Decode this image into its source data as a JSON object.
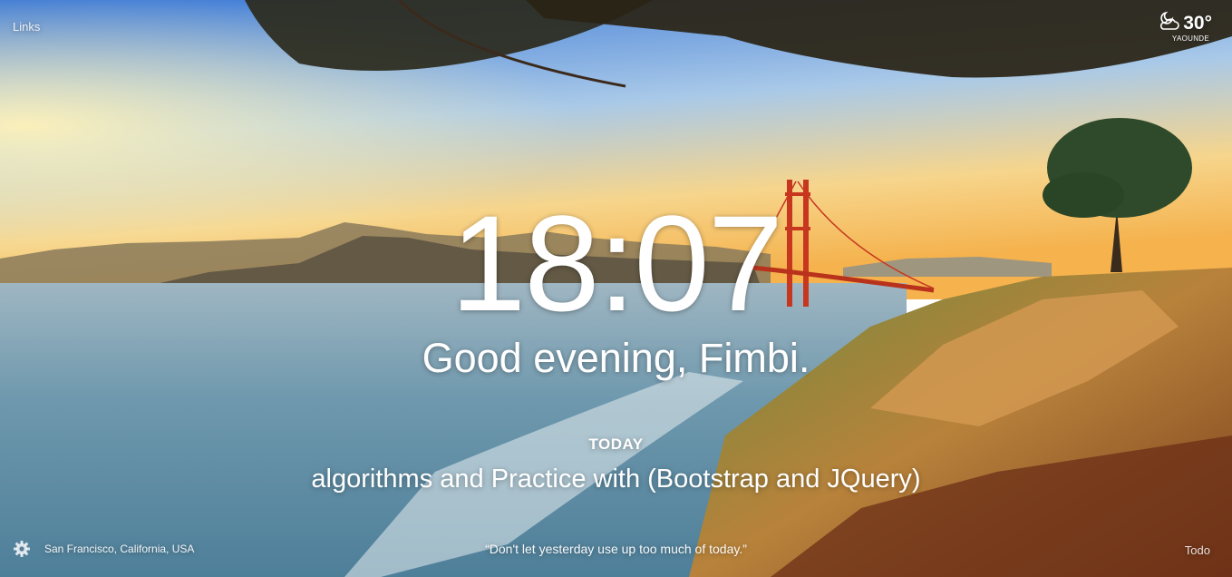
{
  "nav": {
    "links_label": "Links",
    "todo_label": "Todo"
  },
  "weather": {
    "icon": "partly-cloudy-night-icon",
    "temperature": "30°",
    "city": "YAOUNDE"
  },
  "clock": {
    "time": "18:07"
  },
  "greeting": {
    "text": "Good evening, Fimbi."
  },
  "focus": {
    "label": "TODAY",
    "text": "algorithms and Practice with (Bootstrap and JQuery)"
  },
  "footer": {
    "settings_icon": "gear-icon",
    "location": "San Francisco, California, USA",
    "quote": "“Don't let yesterday use up too much of today.”"
  },
  "colors": {
    "sky_top": "#2f6fd0",
    "sky_horizon": "#f5c46a",
    "water": "#5f90a8",
    "bridge": "#c7371f",
    "text": "#ffffff"
  }
}
